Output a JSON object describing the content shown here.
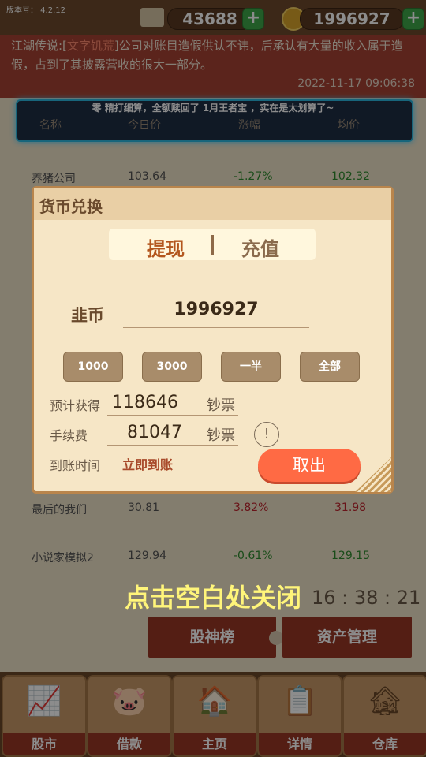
{
  "header": {
    "version": "版本号： 4.2.12",
    "gold": "43688",
    "coins": "1996927"
  },
  "news": {
    "prefix": "江湖传说:[",
    "link": "文字饥荒",
    "suffix": "]公司对账目造假供认不讳，后承认有大量的收入属于造假，占到了其披露营收的很大一部分。",
    "time": "2022-11-17 09:06:38"
  },
  "banner": {
    "text": "零 精打细算，全额赎回了 1月王者宝 ，实在是太划算了~",
    "tab_fragments": [
      "名称",
      "今日价",
      "涨幅",
      "均价"
    ]
  },
  "stocks": [
    {
      "name": "养猪公司",
      "price": "103.64",
      "change": "-1.27%",
      "avg": "102.32"
    },
    {
      "name": "最后的我们",
      "price": "30.81",
      "change": "3.82%",
      "avg": "31.98"
    },
    {
      "name": "小说家模拟2",
      "price": "129.94",
      "change": "-0.61%",
      "avg": "129.15"
    }
  ],
  "countdown": "16 : 38 : 21",
  "buttons": {
    "rank": "股神榜",
    "assets": "资产管理"
  },
  "nav": [
    {
      "label": "股市",
      "icon": "chart-icon"
    },
    {
      "label": "借款",
      "icon": "piggy-bank-icon"
    },
    {
      "label": "主页",
      "icon": "house-icon"
    },
    {
      "label": "详情",
      "icon": "document-icon"
    },
    {
      "label": "仓库",
      "icon": "warehouse-icon"
    }
  ],
  "close_hint": "点击空白处关闭",
  "dialog": {
    "title": "货币兑换",
    "tab_withdraw": "提现",
    "tab_recharge": "充值",
    "currency_label": "韭币",
    "currency_value": "1996927",
    "quick": [
      "1000",
      "3000",
      "一半",
      "全部"
    ],
    "expected_label": "预计获得",
    "expected_value": "118646",
    "unit": "钞票",
    "fee_label": "手续费",
    "fee_value": "81047",
    "arrival_label": "到账时间",
    "arrival_value": "立即到账",
    "withdraw_button": "取出"
  },
  "colors": {
    "up": "#c0262e",
    "down": "#2e8b2e",
    "accent": "#ff6a44"
  }
}
